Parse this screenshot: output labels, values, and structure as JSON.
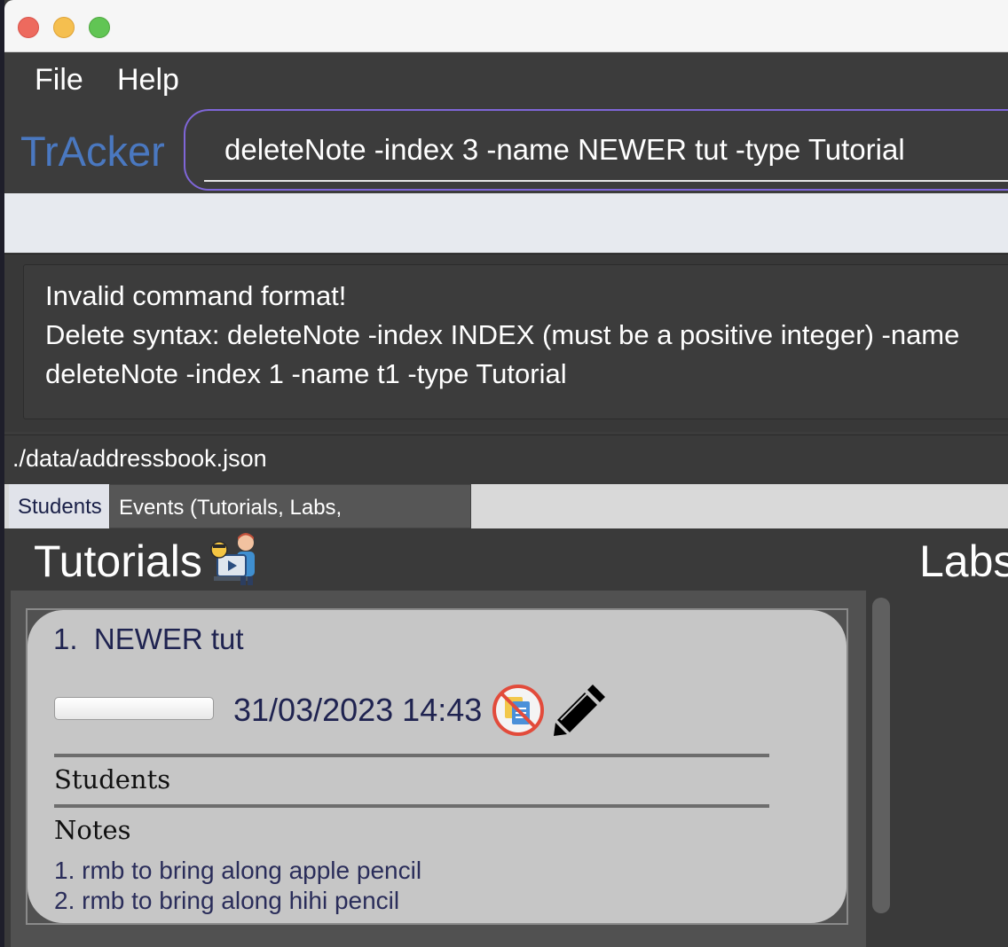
{
  "window": {
    "controls": [
      "close",
      "minimize",
      "maximize"
    ]
  },
  "menu": {
    "file": "File",
    "help": "Help"
  },
  "app": {
    "name": "TrAcker"
  },
  "command": {
    "value": "deleteNote -index 3 -name NEWER tut -type Tutorial"
  },
  "result": {
    "line1": "Invalid command format!",
    "line2": "Delete syntax: deleteNote -index INDEX (must be a positive integer) -name",
    "line3": "deleteNote -index 1 -name t1 -type Tutorial"
  },
  "status": {
    "file_path": "./data/addressbook.json"
  },
  "tabs": {
    "students": "Students",
    "events": "Events (Tutorials, Labs, Consultations)"
  },
  "sections": {
    "tutorials": "Tutorials",
    "labs": "Labs"
  },
  "tutorial_card": {
    "index": "1.",
    "name": "NEWER tut",
    "datetime": "31/03/2023 14:43",
    "progress": 0.0,
    "students_heading": "Students",
    "notes_heading": "Notes",
    "notes": [
      "1. rmb to bring along apple pencil",
      "2. rmb to bring along  hihi pencil"
    ]
  },
  "icons": {
    "tutorial_illustration": "tutor-with-laptop-icon",
    "no_document": "no-document-icon",
    "edit": "pencil-icon"
  },
  "colors": {
    "accent": "#7f66d8",
    "brand": "#4a78c0",
    "card_bg": "#c6c6c6",
    "card_text": "#1f2350"
  }
}
